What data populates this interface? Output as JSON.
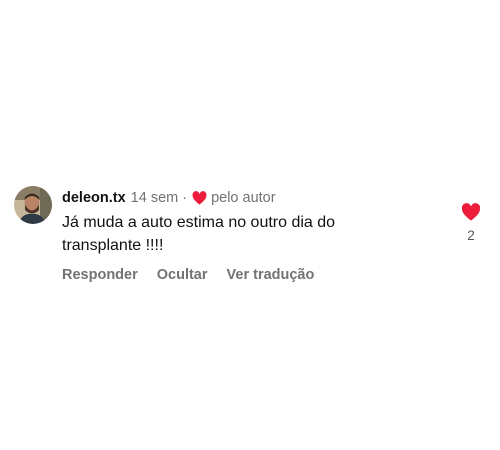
{
  "comment": {
    "username": "deleon.tx",
    "time": "14 sem",
    "separator": "·",
    "liked_by_author": "pelo autor",
    "text_line1": "Já muda a auto estima no outro dia do",
    "text_line2": "transplante !!!!",
    "actions": {
      "reply": "Responder",
      "hide": "Ocultar",
      "translate": "Ver tradução"
    },
    "like_count": "2",
    "heart_color": "#ed1c3a",
    "avatar_icon": "avatar"
  }
}
